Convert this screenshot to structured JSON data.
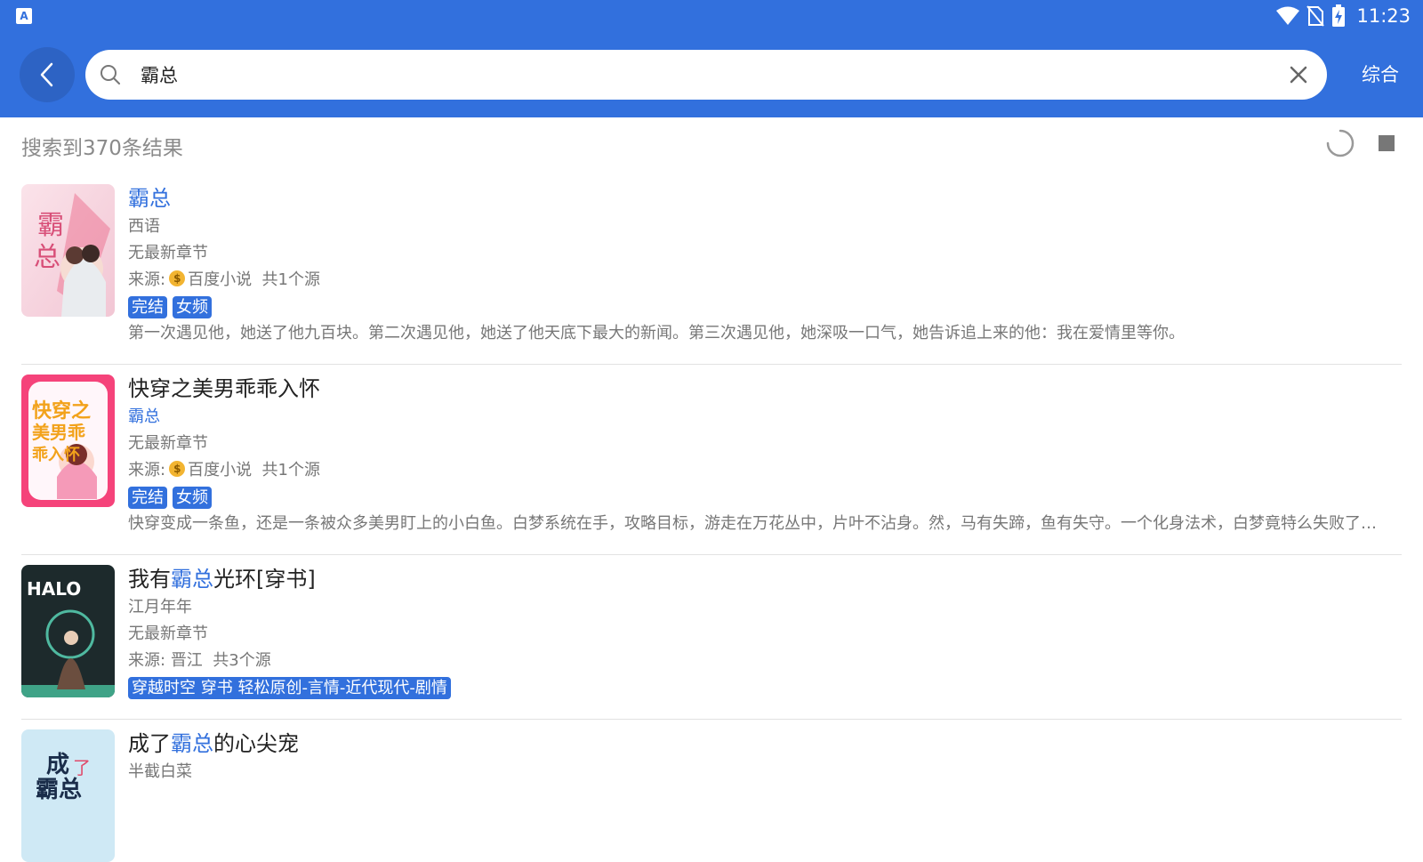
{
  "status_bar": {
    "time": "11:23",
    "app_icon_label": "A"
  },
  "search": {
    "query": "霸总",
    "filter_label": "综合"
  },
  "results": {
    "count_text": "搜索到370条结果"
  },
  "books": [
    {
      "title_before": "",
      "title_highlight": "霸总",
      "title_after": "",
      "author": "西语",
      "author_highlighted": false,
      "latest": "无最新章节",
      "source_prefix": "来源:",
      "source_name": "百度小说",
      "source_count": "共1个源",
      "tags": [
        "完结",
        "女频"
      ],
      "intro": "第一次遇见他，她送了他九百块。第二次遇见他，她送了他天底下最大的新闻。第三次遇见他，她深吸一口气，她告诉追上来的他：我在爱情里等你。",
      "cover_text": "霸总"
    },
    {
      "title_before": "快穿之美男乖乖入怀",
      "title_highlight": "",
      "title_after": "",
      "author": "霸总",
      "author_highlighted": true,
      "latest": "无最新章节",
      "source_prefix": "来源:",
      "source_name": "百度小说",
      "source_count": "共1个源",
      "tags": [
        "完结",
        "女频"
      ],
      "intro": "快穿变成一条鱼，还是一条被众多美男盯上的小白鱼。白梦系统在手，攻略目标，游走在万花丛中，片叶不沾身。然，马有失蹄，鱼有失守。一个化身法术，白梦竟特么失败了。...",
      "cover_text": "快穿之美男乖乖入怀"
    },
    {
      "title_before": "我有",
      "title_highlight": "霸总",
      "title_after": "光环[穿书]",
      "author": "江月年年",
      "author_highlighted": false,
      "latest": "无最新章节",
      "source_prefix": "来源:",
      "source_name": "晋江",
      "source_count": "共3个源",
      "tags": [
        "穿越时空 穿书 轻松原创-言情-近代现代-剧情"
      ],
      "intro": "",
      "cover_text": "HALO"
    },
    {
      "title_before": "成了",
      "title_highlight": "霸总",
      "title_after": "的心尖宠",
      "author": "半截白菜",
      "author_highlighted": false,
      "latest": "",
      "source_prefix": "",
      "source_name": "",
      "source_count": "",
      "tags": [],
      "intro": "",
      "cover_text": "成了霸总"
    }
  ],
  "colors": {
    "primary": "#3270dd",
    "text_secondary": "#777777"
  }
}
